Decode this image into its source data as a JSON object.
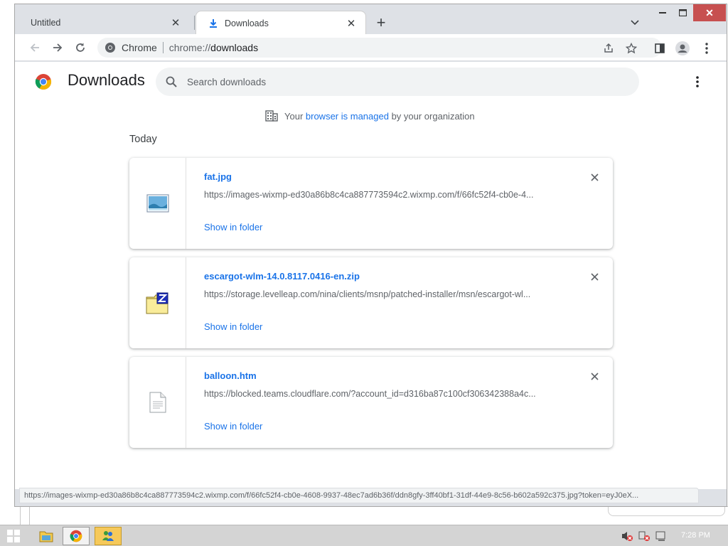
{
  "browser": {
    "tabs": [
      {
        "title": "Untitled",
        "active": false
      },
      {
        "title": "Downloads",
        "active": true
      }
    ],
    "omnibox": {
      "site_label": "Chrome",
      "url_scheme": "chrome://",
      "url_host": "downloads"
    },
    "status_url": "https://images-wixmp-ed30a86b8c4ca887773594c2.wixmp.com/f/66fc52f4-cb0e-4608-9937-48ec7ad6b36f/ddn8gfy-3ff40bf1-31df-44e9-8c56-b602a592c375.jpg?token=eyJ0eX..."
  },
  "downloads_page": {
    "title": "Downloads",
    "search_placeholder": "Search downloads",
    "managed": {
      "prefix": "Your ",
      "link": "browser is managed",
      "suffix": " by your organization"
    },
    "section_label": "Today",
    "show_in_folder_label": "Show in folder",
    "items": [
      {
        "name": "fat.jpg",
        "url": "https://images-wixmp-ed30a86b8c4ca887773594c2.wixmp.com/f/66fc52f4-cb0e-4...",
        "icon": "image-file-icon"
      },
      {
        "name": "escargot-wlm-14.0.8117.0416-en.zip",
        "url": "https://storage.levelleap.com/nina/clients/msnp/patched-installer/msn/escargot-wl...",
        "icon": "zip-file-icon"
      },
      {
        "name": "balloon.htm",
        "url": "https://blocked.teams.cloudflare.com/?account_id=d316ba87c100cf306342388a4c...",
        "icon": "document-file-icon"
      }
    ]
  },
  "taskbar": {
    "clock": "7:28 PM"
  },
  "colors": {
    "accent": "#1a73e8",
    "close_red": "#c75050",
    "highlight_app": "#f6c95a"
  }
}
